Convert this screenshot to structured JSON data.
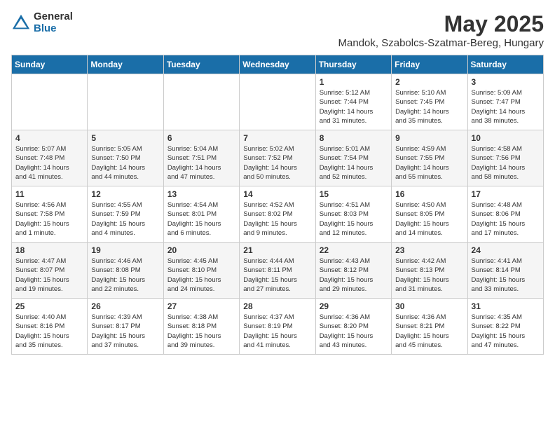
{
  "logo": {
    "general": "General",
    "blue": "Blue"
  },
  "title": "May 2025",
  "subtitle": "Mandok, Szabolcs-Szatmar-Bereg, Hungary",
  "days_header": [
    "Sunday",
    "Monday",
    "Tuesday",
    "Wednesday",
    "Thursday",
    "Friday",
    "Saturday"
  ],
  "weeks": [
    [
      {
        "day": "",
        "info": ""
      },
      {
        "day": "",
        "info": ""
      },
      {
        "day": "",
        "info": ""
      },
      {
        "day": "",
        "info": ""
      },
      {
        "day": "1",
        "info": "Sunrise: 5:12 AM\nSunset: 7:44 PM\nDaylight: 14 hours\nand 31 minutes."
      },
      {
        "day": "2",
        "info": "Sunrise: 5:10 AM\nSunset: 7:45 PM\nDaylight: 14 hours\nand 35 minutes."
      },
      {
        "day": "3",
        "info": "Sunrise: 5:09 AM\nSunset: 7:47 PM\nDaylight: 14 hours\nand 38 minutes."
      }
    ],
    [
      {
        "day": "4",
        "info": "Sunrise: 5:07 AM\nSunset: 7:48 PM\nDaylight: 14 hours\nand 41 minutes."
      },
      {
        "day": "5",
        "info": "Sunrise: 5:05 AM\nSunset: 7:50 PM\nDaylight: 14 hours\nand 44 minutes."
      },
      {
        "day": "6",
        "info": "Sunrise: 5:04 AM\nSunset: 7:51 PM\nDaylight: 14 hours\nand 47 minutes."
      },
      {
        "day": "7",
        "info": "Sunrise: 5:02 AM\nSunset: 7:52 PM\nDaylight: 14 hours\nand 50 minutes."
      },
      {
        "day": "8",
        "info": "Sunrise: 5:01 AM\nSunset: 7:54 PM\nDaylight: 14 hours\nand 52 minutes."
      },
      {
        "day": "9",
        "info": "Sunrise: 4:59 AM\nSunset: 7:55 PM\nDaylight: 14 hours\nand 55 minutes."
      },
      {
        "day": "10",
        "info": "Sunrise: 4:58 AM\nSunset: 7:56 PM\nDaylight: 14 hours\nand 58 minutes."
      }
    ],
    [
      {
        "day": "11",
        "info": "Sunrise: 4:56 AM\nSunset: 7:58 PM\nDaylight: 15 hours\nand 1 minute."
      },
      {
        "day": "12",
        "info": "Sunrise: 4:55 AM\nSunset: 7:59 PM\nDaylight: 15 hours\nand 4 minutes."
      },
      {
        "day": "13",
        "info": "Sunrise: 4:54 AM\nSunset: 8:01 PM\nDaylight: 15 hours\nand 6 minutes."
      },
      {
        "day": "14",
        "info": "Sunrise: 4:52 AM\nSunset: 8:02 PM\nDaylight: 15 hours\nand 9 minutes."
      },
      {
        "day": "15",
        "info": "Sunrise: 4:51 AM\nSunset: 8:03 PM\nDaylight: 15 hours\nand 12 minutes."
      },
      {
        "day": "16",
        "info": "Sunrise: 4:50 AM\nSunset: 8:05 PM\nDaylight: 15 hours\nand 14 minutes."
      },
      {
        "day": "17",
        "info": "Sunrise: 4:48 AM\nSunset: 8:06 PM\nDaylight: 15 hours\nand 17 minutes."
      }
    ],
    [
      {
        "day": "18",
        "info": "Sunrise: 4:47 AM\nSunset: 8:07 PM\nDaylight: 15 hours\nand 19 minutes."
      },
      {
        "day": "19",
        "info": "Sunrise: 4:46 AM\nSunset: 8:08 PM\nDaylight: 15 hours\nand 22 minutes."
      },
      {
        "day": "20",
        "info": "Sunrise: 4:45 AM\nSunset: 8:10 PM\nDaylight: 15 hours\nand 24 minutes."
      },
      {
        "day": "21",
        "info": "Sunrise: 4:44 AM\nSunset: 8:11 PM\nDaylight: 15 hours\nand 27 minutes."
      },
      {
        "day": "22",
        "info": "Sunrise: 4:43 AM\nSunset: 8:12 PM\nDaylight: 15 hours\nand 29 minutes."
      },
      {
        "day": "23",
        "info": "Sunrise: 4:42 AM\nSunset: 8:13 PM\nDaylight: 15 hours\nand 31 minutes."
      },
      {
        "day": "24",
        "info": "Sunrise: 4:41 AM\nSunset: 8:14 PM\nDaylight: 15 hours\nand 33 minutes."
      }
    ],
    [
      {
        "day": "25",
        "info": "Sunrise: 4:40 AM\nSunset: 8:16 PM\nDaylight: 15 hours\nand 35 minutes."
      },
      {
        "day": "26",
        "info": "Sunrise: 4:39 AM\nSunset: 8:17 PM\nDaylight: 15 hours\nand 37 minutes."
      },
      {
        "day": "27",
        "info": "Sunrise: 4:38 AM\nSunset: 8:18 PM\nDaylight: 15 hours\nand 39 minutes."
      },
      {
        "day": "28",
        "info": "Sunrise: 4:37 AM\nSunset: 8:19 PM\nDaylight: 15 hours\nand 41 minutes."
      },
      {
        "day": "29",
        "info": "Sunrise: 4:36 AM\nSunset: 8:20 PM\nDaylight: 15 hours\nand 43 minutes."
      },
      {
        "day": "30",
        "info": "Sunrise: 4:36 AM\nSunset: 8:21 PM\nDaylight: 15 hours\nand 45 minutes."
      },
      {
        "day": "31",
        "info": "Sunrise: 4:35 AM\nSunset: 8:22 PM\nDaylight: 15 hours\nand 47 minutes."
      }
    ]
  ]
}
